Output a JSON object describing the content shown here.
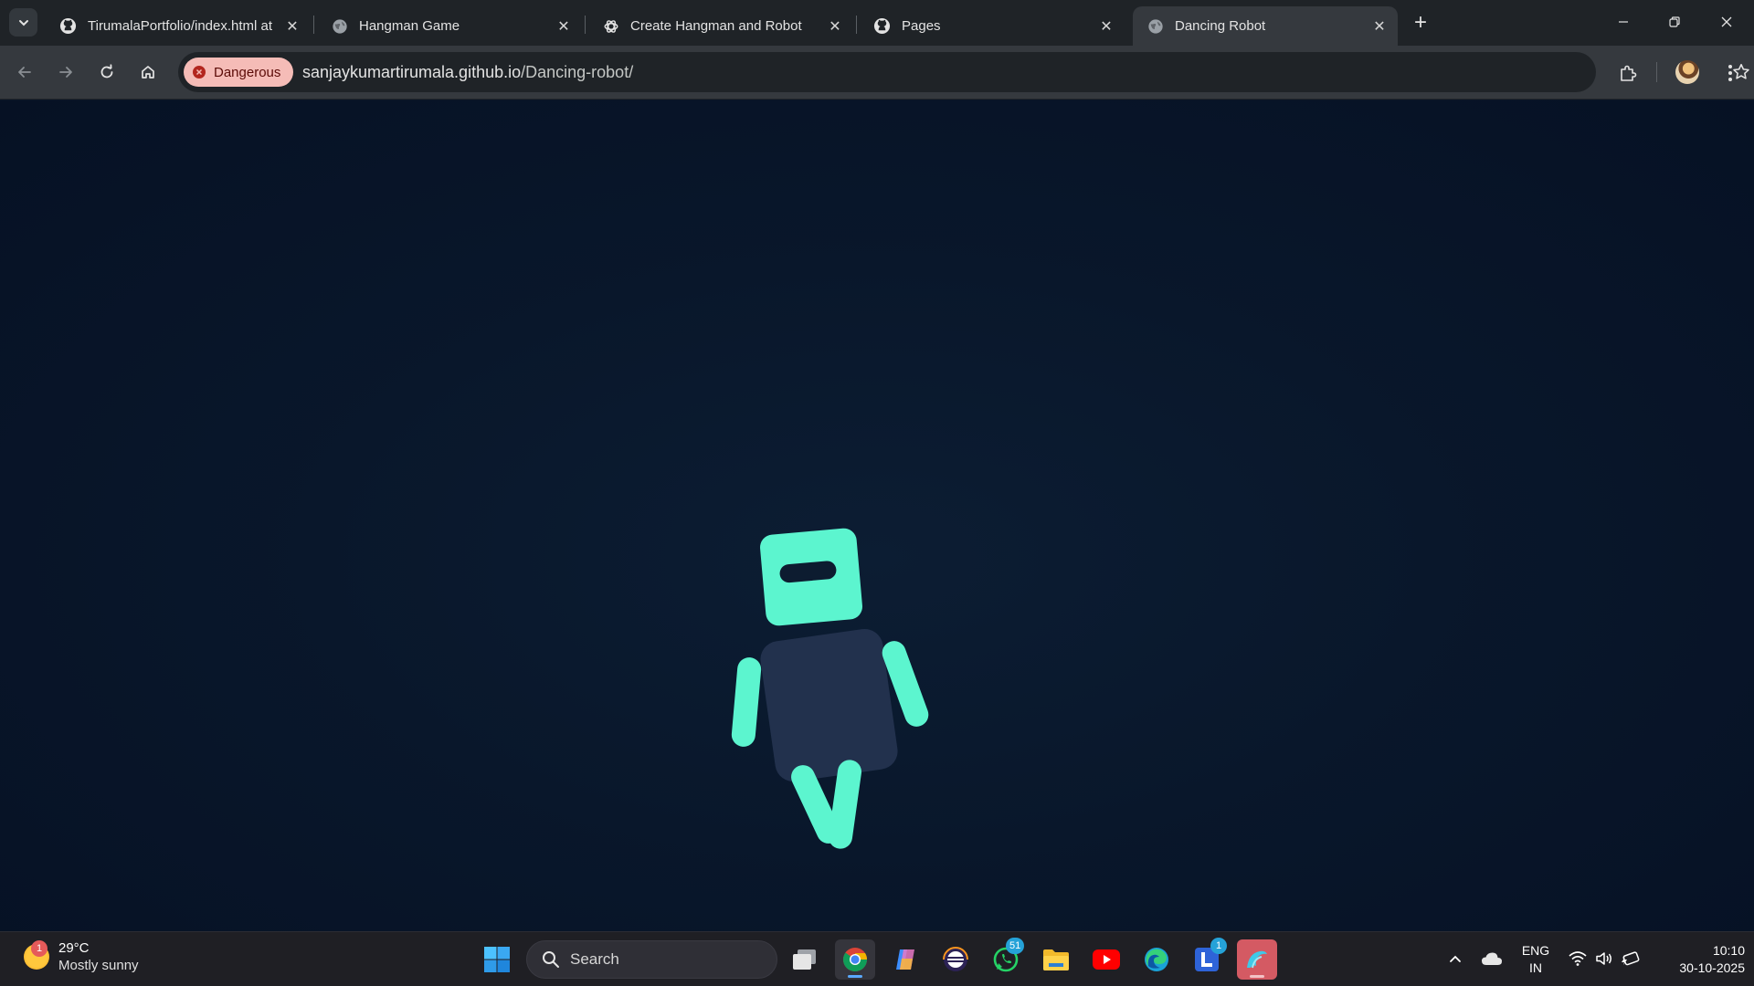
{
  "browser": {
    "tabs": [
      {
        "title": "TirumalaPortfolio/index.html at",
        "favicon": "github-icon",
        "active": false
      },
      {
        "title": "Hangman Game",
        "favicon": "globe-icon",
        "active": false
      },
      {
        "title": "Create Hangman and Robot",
        "favicon": "openai-icon",
        "active": false
      },
      {
        "title": "Pages",
        "favicon": "github-icon",
        "active": false
      },
      {
        "title": "Dancing Robot",
        "favicon": "globe-icon",
        "active": true
      }
    ],
    "new_tab_label": "+",
    "security_label": "Dangerous",
    "url_host": "sanjaykumartirumala.github.io",
    "url_path": "/Dancing-robot/"
  },
  "page": {
    "background": "#061124",
    "robot_color": "#5cf5cf",
    "robot_body_color": "#22314d"
  },
  "taskbar": {
    "weather_temp": "29°C",
    "weather_desc": "Mostly sunny",
    "weather_badge": "1",
    "search_placeholder": "Search",
    "whatsapp_badge": "51",
    "lens_badge": "1",
    "lang_line1": "ENG",
    "lang_line2": "IN",
    "time": "10:10",
    "date": "30-10-2025"
  }
}
